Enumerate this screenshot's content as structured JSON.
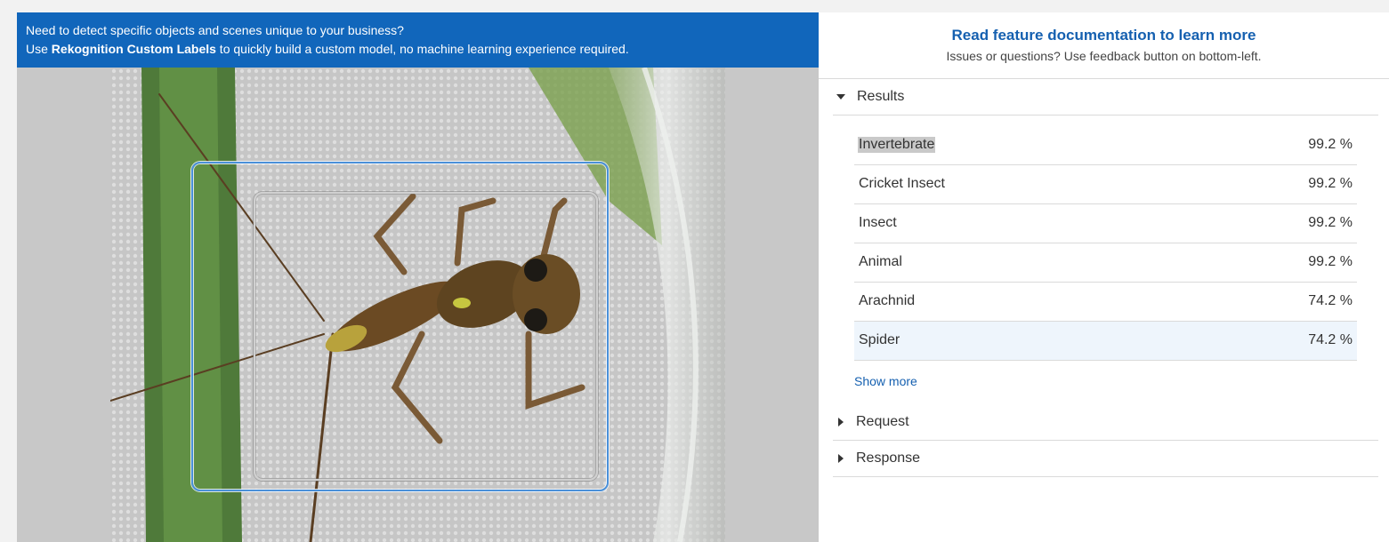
{
  "banner": {
    "line1": "Need to detect specific objects and scenes unique to your business?",
    "line2_prefix": "Use ",
    "line2_bold": "Rekognition Custom Labels",
    "line2_suffix": " to quickly build a custom model, no machine learning experience required."
  },
  "docs": {
    "link": "Read feature documentation to learn more",
    "subtext": "Issues or questions? Use feedback button on bottom-left."
  },
  "sections": {
    "results": "Results",
    "request": "Request",
    "response": "Response"
  },
  "results": [
    {
      "label": "Invertebrate",
      "confidence": "99.2 %"
    },
    {
      "label": "Cricket Insect",
      "confidence": "99.2 %"
    },
    {
      "label": "Insect",
      "confidence": "99.2 %"
    },
    {
      "label": "Animal",
      "confidence": "99.2 %"
    },
    {
      "label": "Arachnid",
      "confidence": "74.2 %"
    },
    {
      "label": "Spider",
      "confidence": "74.2 %"
    }
  ],
  "show_more": "Show more",
  "colors": {
    "banner": "#1166bb",
    "link": "#1560b0",
    "bbox_primary": "#4a90d9",
    "bbox_secondary": "#d0d0d0",
    "row_highlight": "#eef5fc"
  }
}
